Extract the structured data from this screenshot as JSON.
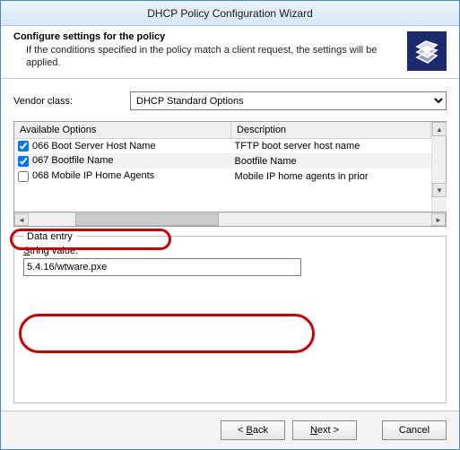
{
  "window": {
    "title": "DHCP Policy Configuration Wizard"
  },
  "header": {
    "title": "Configure settings for the policy",
    "subtitle": "If the conditions specified in the policy match a client request, the settings will be applied."
  },
  "vendor": {
    "label": "Vendor class:",
    "selected": "DHCP Standard Options",
    "options": [
      "DHCP Standard Options"
    ]
  },
  "options_table": {
    "columns": [
      "Available Options",
      "Description"
    ],
    "rows": [
      {
        "checked": true,
        "label": "066 Boot Server Host Name",
        "desc": "TFTP boot server host name"
      },
      {
        "checked": true,
        "label": "067 Bootfile Name",
        "desc": "Bootfile Name",
        "selected": true
      },
      {
        "checked": false,
        "label": "068 Mobile IP Home Agents",
        "desc": "Mobile IP home agents in prior"
      }
    ]
  },
  "data_entry": {
    "legend": "Data entry",
    "string_label": "String value:",
    "string_value": "5.4.16/wtware.pxe"
  },
  "buttons": {
    "back": "Back",
    "next": "Next",
    "cancel": "Cancel"
  }
}
